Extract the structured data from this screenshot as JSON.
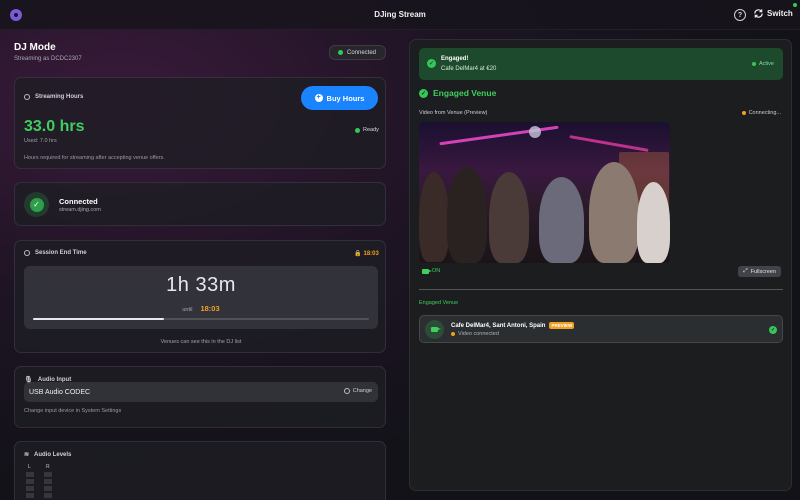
{
  "window": {
    "title": "DJing Stream",
    "help_label": "?",
    "switch_label": "Switch"
  },
  "dj": {
    "title": "DJ Mode",
    "streaming_as": "Streaming as DCDC2307",
    "status": "Connected"
  },
  "hours": {
    "header": "Streaming Hours",
    "buy_label": "Buy Hours",
    "value": "33.0 hrs",
    "used": "Used: 7.0 hrs",
    "status": "Ready",
    "note": "Hours required for streaming after accepting venue offers."
  },
  "connection": {
    "title": "Connected",
    "host": "stream.djing.com"
  },
  "session": {
    "header": "Session End Time",
    "end_time": "18:03",
    "remaining": "1h 33m",
    "until_label": "until",
    "until_time": "18:03",
    "progress": 0.39,
    "note": "Venues can see this in the DJ list"
  },
  "audio_input": {
    "header": "Audio Input",
    "device": "USB Audio CODEC",
    "change_label": "Change",
    "hint": "Change input device in System Settings"
  },
  "audio_levels": {
    "header": "Audio Levels",
    "left_label": "L",
    "right_label": "R"
  },
  "engaged": {
    "title": "Engaged!",
    "subtitle": "Cafe DelMar4 at €20",
    "status": "Active"
  },
  "engaged_venue": {
    "header": "Engaged Venue",
    "video_label": "Video from Venue (Preview)",
    "video_status": "Connecting...",
    "on_label": "ON",
    "fullscreen_label": "Fullscreen",
    "section_label": "Engaged Venue",
    "venue_name": "Cafe DelMar4, Sant Antoni, Spain",
    "preview_tag": "PREVIEW",
    "venue_status": "Video connected"
  },
  "colors": {
    "accent": "#1a84ff",
    "success": "#34c759",
    "warning": "#f0a020"
  }
}
